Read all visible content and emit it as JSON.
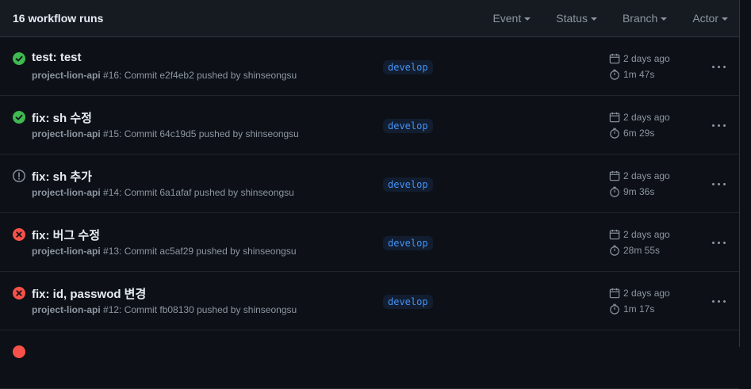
{
  "header": {
    "title": "16 workflow runs",
    "filters": [
      "Event",
      "Status",
      "Branch",
      "Actor"
    ]
  },
  "colors": {
    "success": "#3fb950",
    "failure": "#f85149",
    "neutral": "#8d96a0"
  },
  "runs": [
    {
      "status": "success",
      "status_icon": "check-circle-icon",
      "title": "test: test",
      "workflow": "project-lion-api",
      "detail": "#16: Commit e2f4eb2 pushed by shinseongsu",
      "branch": "develop",
      "date": "2 days ago",
      "duration": "1m 47s"
    },
    {
      "status": "success",
      "status_icon": "check-circle-icon",
      "title": "fix: sh 수정",
      "workflow": "project-lion-api",
      "detail": "#15: Commit 64c19d5 pushed by shinseongsu",
      "branch": "develop",
      "date": "2 days ago",
      "duration": "6m 29s"
    },
    {
      "status": "cancelled",
      "status_icon": "alert-circle-icon",
      "title": "fix: sh 추가",
      "workflow": "project-lion-api",
      "detail": "#14: Commit 6a1afaf pushed by shinseongsu",
      "branch": "develop",
      "date": "2 days ago",
      "duration": "9m 36s"
    },
    {
      "status": "failure",
      "status_icon": "x-circle-icon",
      "title": "fix: 버그 수정",
      "workflow": "project-lion-api",
      "detail": "#13: Commit ac5af29 pushed by shinseongsu",
      "branch": "develop",
      "date": "2 days ago",
      "duration": "28m 55s"
    },
    {
      "status": "failure",
      "status_icon": "x-circle-icon",
      "title": "fix: id, passwod 변경",
      "workflow": "project-lion-api",
      "detail": "#12: Commit fb08130 pushed by shinseongsu",
      "branch": "develop",
      "date": "2 days ago",
      "duration": "1m 17s"
    }
  ]
}
